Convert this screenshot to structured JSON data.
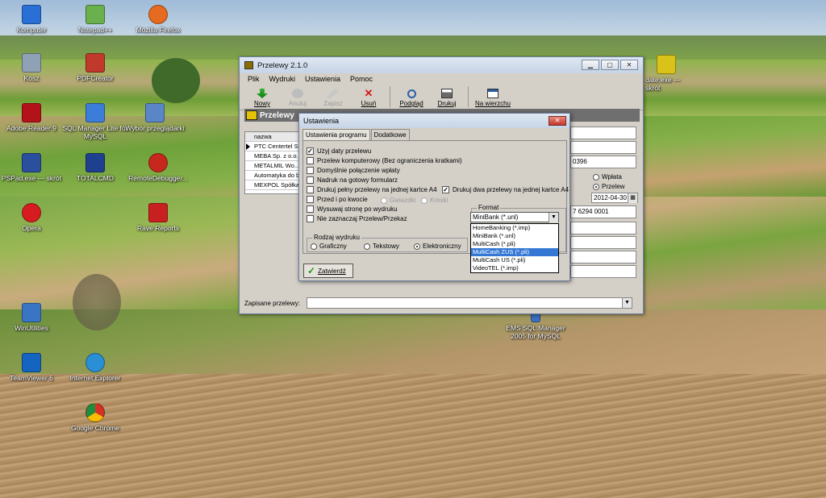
{
  "desktop_icons": [
    {
      "label": "Komputer",
      "color": "#2a6fd6"
    },
    {
      "label": "Notepad++",
      "color": "#6ab04c"
    },
    {
      "label": "Mozilla Firefox",
      "color": "#e66a1f"
    },
    {
      "label": "Kosz",
      "color": "#8fa2b5"
    },
    {
      "label": "PDFCreator",
      "color": "#c0392b"
    },
    {
      "label": "Adobe Reader 9",
      "color": "#b3121a"
    },
    {
      "label": "SQL Manager Lite for MySQL",
      "color": "#3b7dd8"
    },
    {
      "label": "Wybór przeglądarki",
      "color": "#5a86c8"
    },
    {
      "label": "PSPad.exe — skrót",
      "color": "#2a4f9c"
    },
    {
      "label": "TOTALCMD",
      "color": "#1f3f8f"
    },
    {
      "label": "RemoteDebugger...",
      "color": "#c7281d"
    },
    {
      "label": "Opera",
      "color": "#d61b21"
    },
    {
      "label": "Rave Reports",
      "color": "#c82020"
    },
    {
      "label": "WinUtilities",
      "color": "#3a75c4"
    },
    {
      "label": "TeamViewer 6",
      "color": "#1565c0"
    },
    {
      "label": "Internet Explorer",
      "color": "#2b8fd6"
    },
    {
      "label": "Google Chrome",
      "color": "#e1a41a"
    },
    {
      "label": "date.exe — skrót",
      "color": "#d9c21a"
    },
    {
      "label": "EMS SQL Manager 2005 for MySQL",
      "color": "#3a6fc2"
    }
  ],
  "window": {
    "title": "Przelewy 2.1.0",
    "menu": [
      "Plik",
      "Wydruki",
      "Ustawienia",
      "Pomoc"
    ],
    "toolbar": {
      "new": "Nowy",
      "cancel": "Anuluj",
      "save": "Zapisz",
      "delete": "Usuń",
      "preview": "Podgląd",
      "print": "Drukuj",
      "top": "Na wierzchu"
    },
    "band_title": "Przelewy",
    "grid_header": "nazwa",
    "grid_rows": [
      "PTC Centertel Sp.",
      "MEBA Sp. z o.o.",
      "METALMIL Wo...",
      "Automatyka do b...",
      "MEXPOL Spółka..."
    ],
    "right_fields": {
      "account_tail": "0396",
      "radio_in": "Wpłata",
      "radio_out": "Przelew",
      "date": "2012-04-30",
      "nrb": "7 6294 0001"
    },
    "saved_label": "Zapisane przelewy:"
  },
  "dialog": {
    "title": "Ustawienia",
    "tabs": [
      "Ustawienia programu",
      "Dodatkowe"
    ],
    "options": [
      {
        "label": "Użyj daty przelewu",
        "checked": true
      },
      {
        "label": "Przelew komputerowy (Bez ograniczenia kratkami)",
        "checked": false
      },
      {
        "label": "Domyślnie połączenie wpłaty",
        "checked": false
      },
      {
        "label": "Nadruk na gotowy formularz",
        "checked": false
      },
      {
        "label": "Drukuj pełny przelewy na jednej kartce A4",
        "checked": false
      },
      {
        "label": "Przed i po kwocie",
        "checked": false
      },
      {
        "label": "Wysuwaj stronę po wydruku",
        "checked": false
      },
      {
        "label": "Nie zaznaczaj Przelew/Przekaz",
        "checked": false
      }
    ],
    "print_two": {
      "label": "Drukuj dwa przelewy na jednej kartce A4",
      "checked": true
    },
    "around_amount": {
      "stars": "Gwiazdki",
      "dashes": "Kreski"
    },
    "print_kind": {
      "label": "Rodzaj wydruku",
      "graphic": "Graficzny",
      "text": "Tekstowy",
      "electronic": "Elektroniczny",
      "selected": "electronic"
    },
    "format": {
      "label": "Format",
      "selected": "MiniBank (*.unl)",
      "options": [
        "HomeBanking (*.imp)",
        "MiniBank (*.unl)",
        "MultiCash (*.pli)",
        "MultiCash ZUS (*.pli)",
        "MultiCash US (*.pli)",
        "VideoTEL (*.imp)"
      ],
      "highlighted_index": 3
    },
    "ok": "Zatwierdź"
  }
}
